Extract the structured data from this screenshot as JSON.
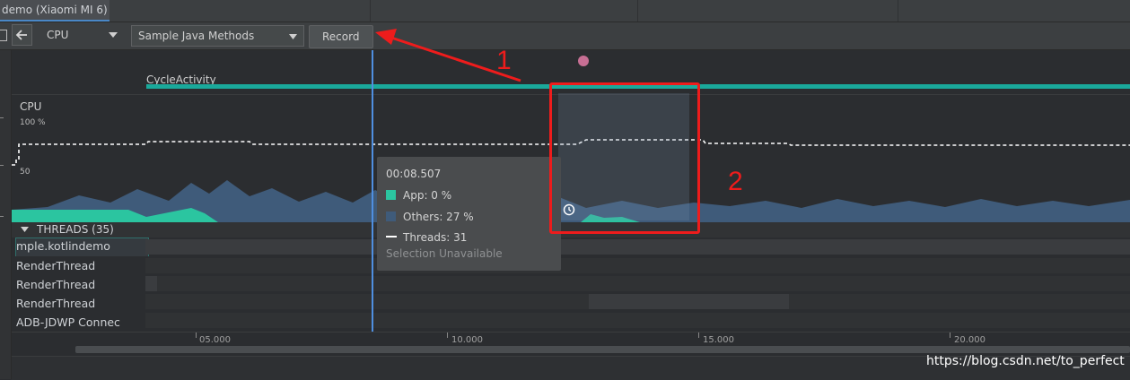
{
  "window": {
    "tab_title": "demo (Xiaomi MI 6)"
  },
  "toolbar": {
    "profiler_select": "CPU",
    "config_select": "Sample Java Methods",
    "record_label": "Record"
  },
  "events": {
    "activity_label": "CycleActivity"
  },
  "cpu": {
    "label": "CPU",
    "y_max_label": "100 %",
    "y_mid_label": "50"
  },
  "threads": {
    "header": "THREADS (35)",
    "items": [
      "mple.kotlindemo",
      "RenderThread",
      "RenderThread",
      "RenderThread",
      "ADB-JDWP Connec"
    ]
  },
  "timeline": {
    "ticks": [
      "05.000",
      "10.000",
      "15.000",
      "20.000"
    ]
  },
  "tooltip": {
    "time": "00:08.507",
    "app": "App: 0 %",
    "others": "Others: 27 %",
    "threads": "Threads: 31",
    "selection": "Selection Unavailable"
  },
  "annotations": {
    "one": "1",
    "two": "2"
  },
  "watermark": "https://blog.csdn.net/to_perfect",
  "colors": {
    "app_series": "#2bc5a0",
    "others_series": "#3f5b7a",
    "activity_bar": "#1aa99b",
    "annotation_red": "#ee1c1c",
    "cursor": "#4f8fe0"
  }
}
